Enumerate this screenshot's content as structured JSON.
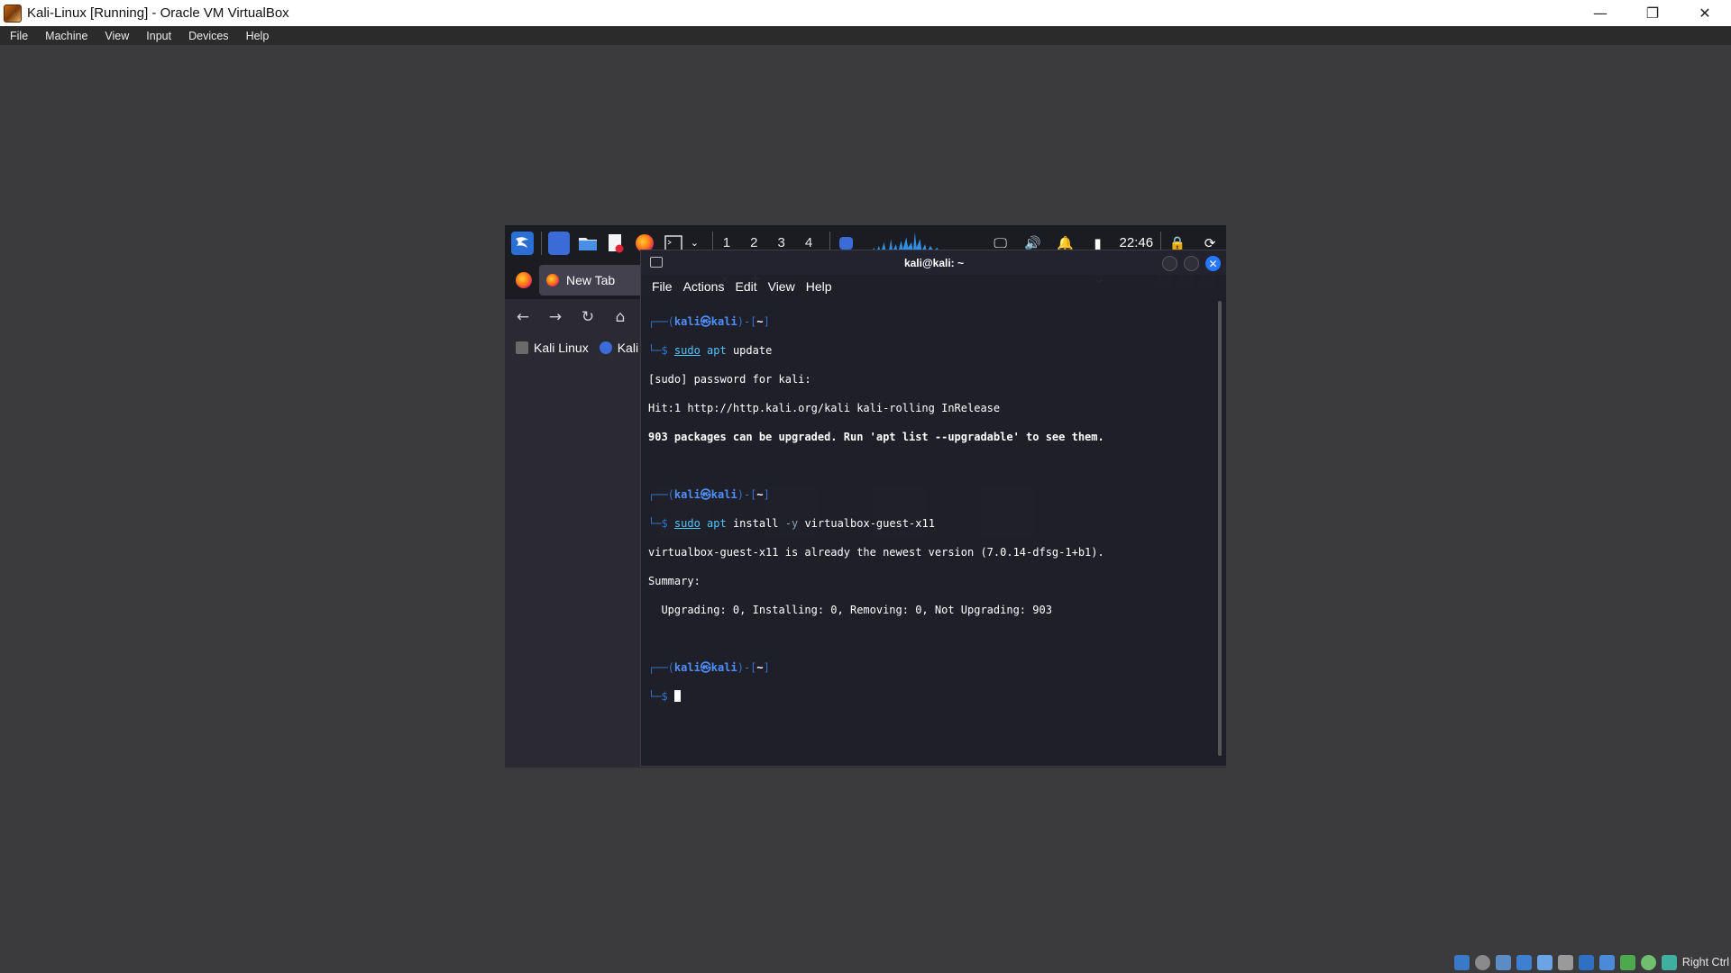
{
  "host": {
    "window_title": "Kali-Linux [Running] - Oracle VM VirtualBox",
    "menu": [
      "File",
      "Machine",
      "View",
      "Input",
      "Devices",
      "Help"
    ],
    "status_key": "Right Ctrl"
  },
  "guest_panel": {
    "workspaces": [
      "1",
      "2",
      "3",
      "4"
    ],
    "active_workspace": "1",
    "clock": "22:46"
  },
  "firefox": {
    "tab_title": "New Tab",
    "bookmarks": [
      "Kali Linux",
      "Kali"
    ]
  },
  "terminal": {
    "title": "kali@kali: ~",
    "menu": [
      "File",
      "Actions",
      "Edit",
      "View",
      "Help"
    ],
    "lines": {
      "p1_host": "kali㉿kali",
      "p1_path": "~",
      "c1_sudo": "sudo",
      "c1_apt": "apt",
      "c1_rest": " update",
      "o1": "[sudo] password for kali:",
      "o2": "Hit:1 http://http.kali.org/kali kali-rolling InRelease",
      "o3": "903 packages can be upgraded. Run 'apt list --upgradable' to see them.",
      "p2_host": "kali㉿kali",
      "p2_path": "~",
      "c2_sudo": "sudo",
      "c2_apt": "apt",
      "c2_mid": " install ",
      "c2_opt": "-y",
      "c2_rest": " virtualbox-guest-x11",
      "o4": "virtualbox-guest-x11 is already the newest version (7.0.14-dfsg-1+b1).",
      "o5": "Summary:",
      "o6": "  Upgrading: 0, Installing: 0, Removing: 0, Not Upgrading: 903",
      "p3_host": "kali㉿kali",
      "p3_path": "~"
    }
  },
  "colors": {
    "prompt_frame": "#2f76c9",
    "prompt_host": "#4f8fff",
    "command": "#52c6ff",
    "close_button": "#2777ff"
  }
}
